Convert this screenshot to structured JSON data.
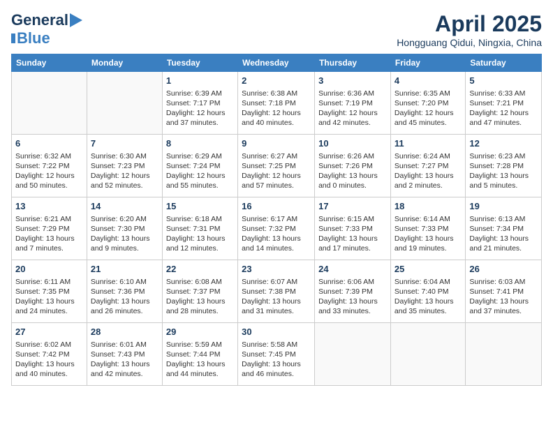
{
  "header": {
    "logo_line1": "General",
    "logo_line2": "Blue",
    "month": "April 2025",
    "location": "Hongguang Qidui, Ningxia, China"
  },
  "weekdays": [
    "Sunday",
    "Monday",
    "Tuesday",
    "Wednesday",
    "Thursday",
    "Friday",
    "Saturday"
  ],
  "weeks": [
    [
      {
        "day": "",
        "info": ""
      },
      {
        "day": "",
        "info": ""
      },
      {
        "day": "1",
        "info": "Sunrise: 6:39 AM\nSunset: 7:17 PM\nDaylight: 12 hours\nand 37 minutes."
      },
      {
        "day": "2",
        "info": "Sunrise: 6:38 AM\nSunset: 7:18 PM\nDaylight: 12 hours\nand 40 minutes."
      },
      {
        "day": "3",
        "info": "Sunrise: 6:36 AM\nSunset: 7:19 PM\nDaylight: 12 hours\nand 42 minutes."
      },
      {
        "day": "4",
        "info": "Sunrise: 6:35 AM\nSunset: 7:20 PM\nDaylight: 12 hours\nand 45 minutes."
      },
      {
        "day": "5",
        "info": "Sunrise: 6:33 AM\nSunset: 7:21 PM\nDaylight: 12 hours\nand 47 minutes."
      }
    ],
    [
      {
        "day": "6",
        "info": "Sunrise: 6:32 AM\nSunset: 7:22 PM\nDaylight: 12 hours\nand 50 minutes."
      },
      {
        "day": "7",
        "info": "Sunrise: 6:30 AM\nSunset: 7:23 PM\nDaylight: 12 hours\nand 52 minutes."
      },
      {
        "day": "8",
        "info": "Sunrise: 6:29 AM\nSunset: 7:24 PM\nDaylight: 12 hours\nand 55 minutes."
      },
      {
        "day": "9",
        "info": "Sunrise: 6:27 AM\nSunset: 7:25 PM\nDaylight: 12 hours\nand 57 minutes."
      },
      {
        "day": "10",
        "info": "Sunrise: 6:26 AM\nSunset: 7:26 PM\nDaylight: 13 hours\nand 0 minutes."
      },
      {
        "day": "11",
        "info": "Sunrise: 6:24 AM\nSunset: 7:27 PM\nDaylight: 13 hours\nand 2 minutes."
      },
      {
        "day": "12",
        "info": "Sunrise: 6:23 AM\nSunset: 7:28 PM\nDaylight: 13 hours\nand 5 minutes."
      }
    ],
    [
      {
        "day": "13",
        "info": "Sunrise: 6:21 AM\nSunset: 7:29 PM\nDaylight: 13 hours\nand 7 minutes."
      },
      {
        "day": "14",
        "info": "Sunrise: 6:20 AM\nSunset: 7:30 PM\nDaylight: 13 hours\nand 9 minutes."
      },
      {
        "day": "15",
        "info": "Sunrise: 6:18 AM\nSunset: 7:31 PM\nDaylight: 13 hours\nand 12 minutes."
      },
      {
        "day": "16",
        "info": "Sunrise: 6:17 AM\nSunset: 7:32 PM\nDaylight: 13 hours\nand 14 minutes."
      },
      {
        "day": "17",
        "info": "Sunrise: 6:15 AM\nSunset: 7:33 PM\nDaylight: 13 hours\nand 17 minutes."
      },
      {
        "day": "18",
        "info": "Sunrise: 6:14 AM\nSunset: 7:33 PM\nDaylight: 13 hours\nand 19 minutes."
      },
      {
        "day": "19",
        "info": "Sunrise: 6:13 AM\nSunset: 7:34 PM\nDaylight: 13 hours\nand 21 minutes."
      }
    ],
    [
      {
        "day": "20",
        "info": "Sunrise: 6:11 AM\nSunset: 7:35 PM\nDaylight: 13 hours\nand 24 minutes."
      },
      {
        "day": "21",
        "info": "Sunrise: 6:10 AM\nSunset: 7:36 PM\nDaylight: 13 hours\nand 26 minutes."
      },
      {
        "day": "22",
        "info": "Sunrise: 6:08 AM\nSunset: 7:37 PM\nDaylight: 13 hours\nand 28 minutes."
      },
      {
        "day": "23",
        "info": "Sunrise: 6:07 AM\nSunset: 7:38 PM\nDaylight: 13 hours\nand 31 minutes."
      },
      {
        "day": "24",
        "info": "Sunrise: 6:06 AM\nSunset: 7:39 PM\nDaylight: 13 hours\nand 33 minutes."
      },
      {
        "day": "25",
        "info": "Sunrise: 6:04 AM\nSunset: 7:40 PM\nDaylight: 13 hours\nand 35 minutes."
      },
      {
        "day": "26",
        "info": "Sunrise: 6:03 AM\nSunset: 7:41 PM\nDaylight: 13 hours\nand 37 minutes."
      }
    ],
    [
      {
        "day": "27",
        "info": "Sunrise: 6:02 AM\nSunset: 7:42 PM\nDaylight: 13 hours\nand 40 minutes."
      },
      {
        "day": "28",
        "info": "Sunrise: 6:01 AM\nSunset: 7:43 PM\nDaylight: 13 hours\nand 42 minutes."
      },
      {
        "day": "29",
        "info": "Sunrise: 5:59 AM\nSunset: 7:44 PM\nDaylight: 13 hours\nand 44 minutes."
      },
      {
        "day": "30",
        "info": "Sunrise: 5:58 AM\nSunset: 7:45 PM\nDaylight: 13 hours\nand 46 minutes."
      },
      {
        "day": "",
        "info": ""
      },
      {
        "day": "",
        "info": ""
      },
      {
        "day": "",
        "info": ""
      }
    ]
  ]
}
